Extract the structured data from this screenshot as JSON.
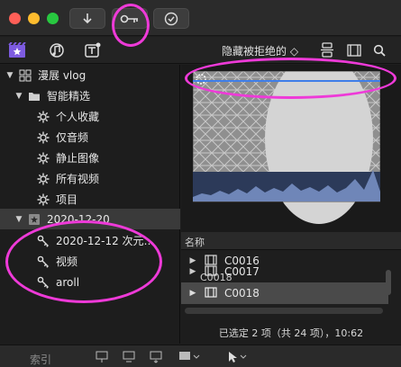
{
  "toolbar": {
    "buttons": [
      {
        "name": "download-icon"
      },
      {
        "name": "key-icon"
      },
      {
        "name": "checkmark-icon"
      }
    ]
  },
  "library_bar": {
    "icons": [
      "photos-library-icon",
      "music-library-icon",
      "titles-generators-icon"
    ],
    "filter_label": "隐藏被拒绝的 ◇",
    "right_icons": [
      "clip-appearance-icon",
      "filmstrip-icon",
      "search-icon"
    ]
  },
  "sidebar": {
    "items": [
      {
        "label": "漫展 vlog",
        "icon": "library-grid-icon",
        "disclosure": "▼"
      },
      {
        "label": "智能精选",
        "icon": "folder-icon",
        "disclosure": "▼"
      },
      {
        "label": "个人收藏",
        "icon": "gear-icon",
        "disclosure": ""
      },
      {
        "label": "仅音频",
        "icon": "gear-icon",
        "disclosure": ""
      },
      {
        "label": "静止图像",
        "icon": "gear-icon",
        "disclosure": ""
      },
      {
        "label": "所有视频",
        "icon": "gear-icon",
        "disclosure": ""
      },
      {
        "label": "项目",
        "icon": "gear-icon",
        "disclosure": ""
      },
      {
        "label": "2020-12-20",
        "icon": "event-star-icon",
        "disclosure": "▼"
      },
      {
        "label": "2020-12-12 次元…",
        "icon": "keyword-icon",
        "disclosure": ""
      },
      {
        "label": "视频",
        "icon": "keyword-icon",
        "disclosure": ""
      },
      {
        "label": "aroll",
        "icon": "keyword-icon",
        "disclosure": ""
      }
    ]
  },
  "viewer": {
    "clip_name": "C0018"
  },
  "list": {
    "header": "名称",
    "rows": [
      {
        "name": "C0016"
      },
      {
        "name": "C0017"
      },
      {
        "name": "C0018"
      }
    ]
  },
  "status": {
    "text": "已选定 2 项（共 24 项），10:62"
  },
  "bottom": {
    "index_label": "索引"
  },
  "annotation_color": "#ee3ad8"
}
